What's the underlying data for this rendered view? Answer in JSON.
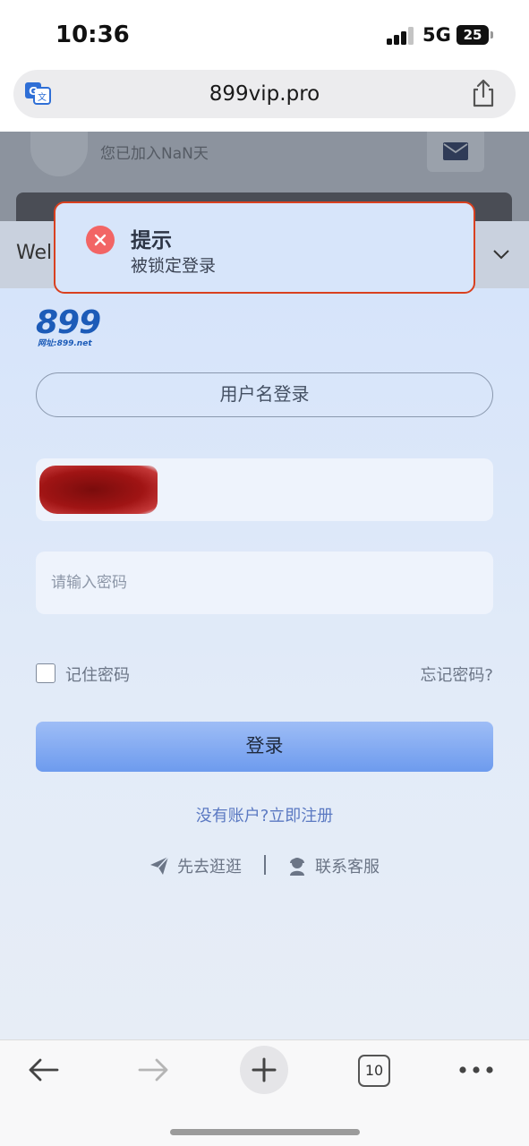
{
  "status_bar": {
    "time": "10:36",
    "network": "5G",
    "battery": "25",
    "battery_level": 0.25
  },
  "browser": {
    "url": "899vip.pro",
    "translate_icon": "translate-icon",
    "share_icon": "share-icon"
  },
  "background_page": {
    "joined_text": "您已加入NaN天",
    "welcome_text": "Wel",
    "mail_icon": "mail-icon",
    "chevron_icon": "chevron-down-icon"
  },
  "login": {
    "logo_number": "899",
    "logo_subtext": "网址:899.net",
    "mode_button": "用户名登录",
    "username_value": "",
    "password_placeholder": "请输入密码",
    "remember_label": "记住密码",
    "forgot_label": "忘记密码?",
    "login_button": "登录",
    "register_text": "没有账户?",
    "register_link": "立即注册",
    "guest_link": "先去逛逛",
    "service_link": "联系客服"
  },
  "toast": {
    "title": "提示",
    "message": "被锁定登录",
    "accent_color": "#f26565",
    "border_color": "#d9401f"
  },
  "toolbar": {
    "tab_count": "10",
    "icons": [
      "back-arrow-icon",
      "forward-arrow-icon",
      "plus-icon",
      "tabs-icon",
      "more-icon"
    ]
  }
}
